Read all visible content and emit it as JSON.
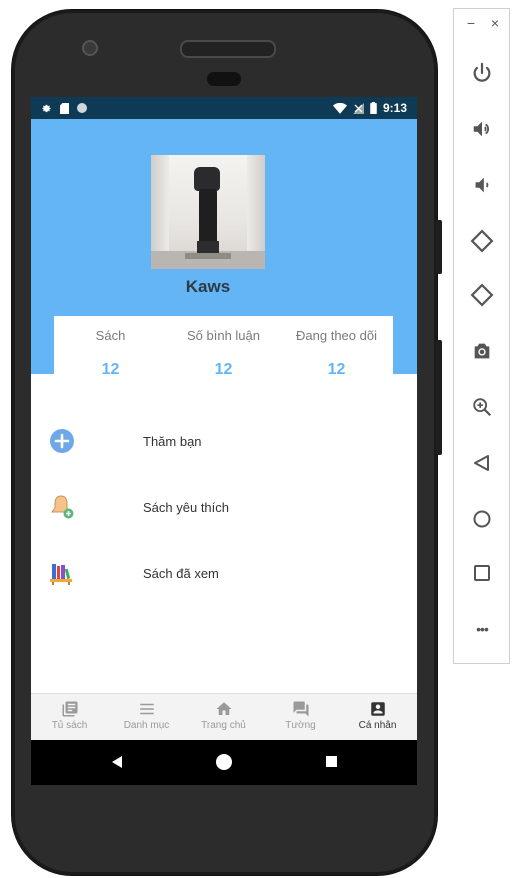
{
  "status_bar": {
    "time": "9:13",
    "left_icons": [
      "gear-icon",
      "sd-card-icon",
      "circle-icon"
    ],
    "right_icons": [
      "wifi-icon",
      "no-signal-icon",
      "battery-icon"
    ]
  },
  "profile": {
    "username": "Kaws"
  },
  "stats": [
    {
      "label": "Sách",
      "value": "12"
    },
    {
      "label": "Số bình luận",
      "value": "12"
    },
    {
      "label": "Đang theo dõi",
      "value": "12"
    }
  ],
  "menu": [
    {
      "label": "Thăm bạn",
      "icon": "plus-circle-icon"
    },
    {
      "label": "Sách yêu thích",
      "icon": "bell-plus-icon"
    },
    {
      "label": "Sách đã xem",
      "icon": "bookshelf-icon"
    }
  ],
  "bottom_nav": [
    {
      "label": "Tủ sách",
      "icon": "library-icon",
      "active": false
    },
    {
      "label": "Danh mục",
      "icon": "menu-icon",
      "active": false
    },
    {
      "label": "Trang chủ",
      "icon": "home-icon",
      "active": false
    },
    {
      "label": "Tường",
      "icon": "chat-icon",
      "active": false
    },
    {
      "label": "Cá nhân",
      "icon": "profile-icon",
      "active": true
    }
  ],
  "emulator_panel": {
    "minimize": "−",
    "close": "×",
    "more": "•••"
  },
  "colors": {
    "header": "#64b5f6",
    "accent": "#64b5f6",
    "status_bar": "#0f3a55"
  }
}
